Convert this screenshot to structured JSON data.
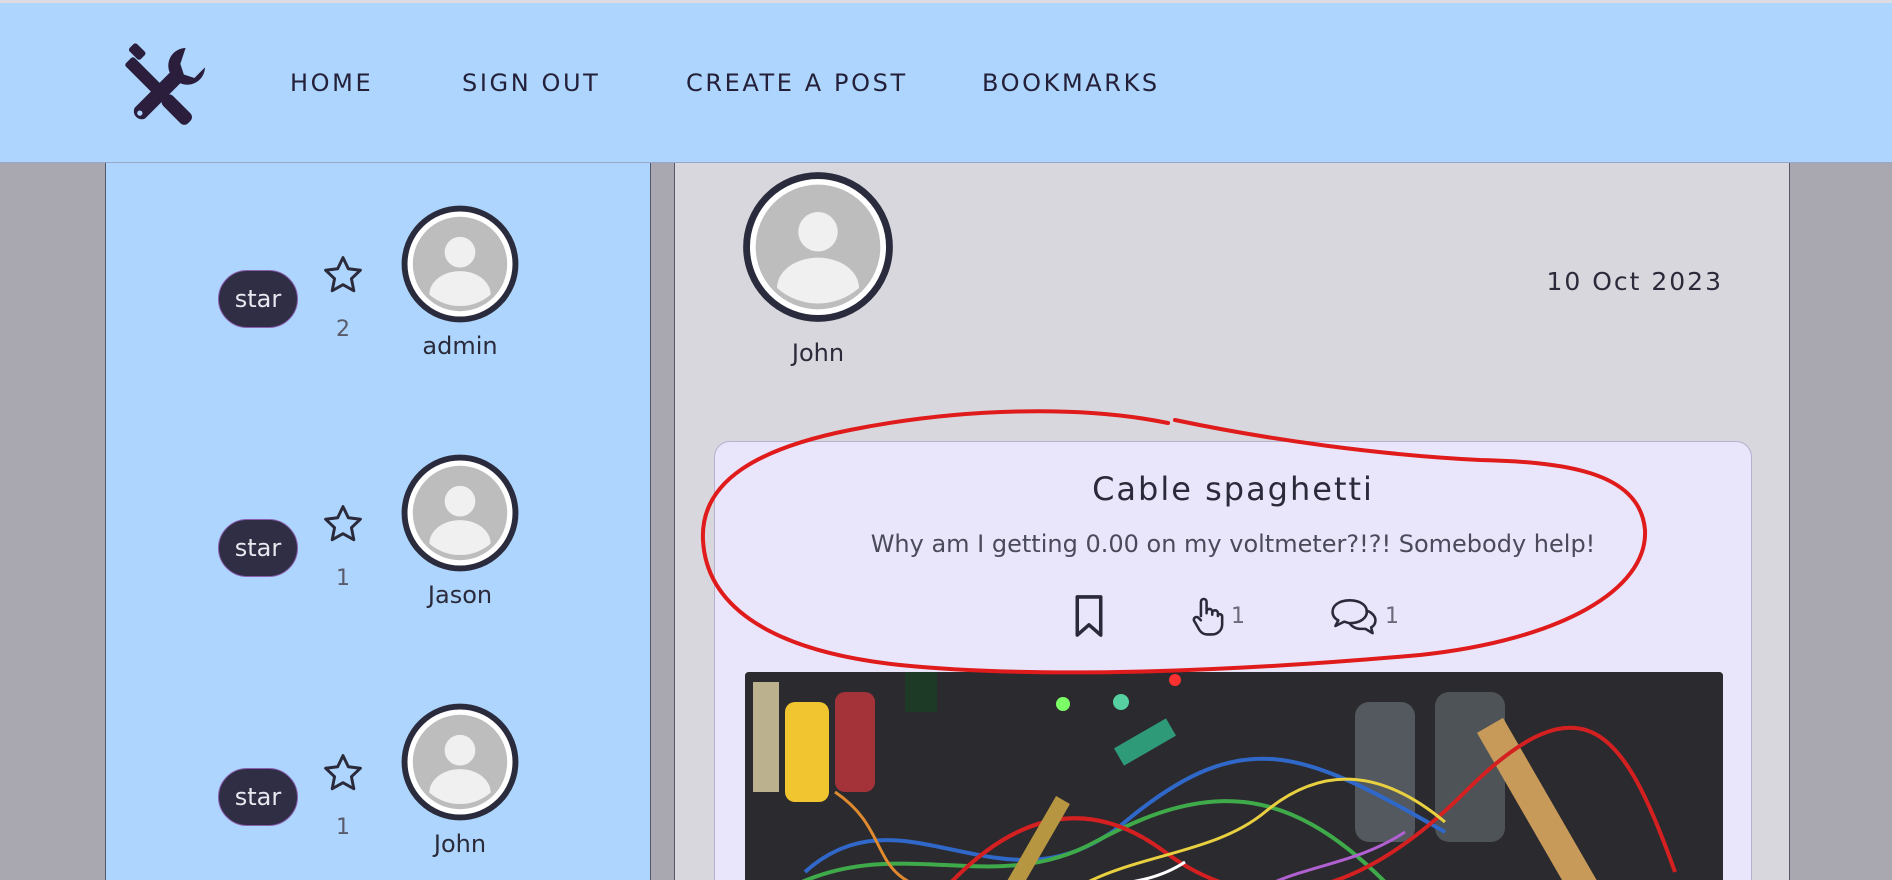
{
  "nav": {
    "links": [
      {
        "label": "HOME"
      },
      {
        "label": "SIGN OUT"
      },
      {
        "label": "CREATE A POST"
      },
      {
        "label": "BOOKMARKS"
      }
    ],
    "logo_icon": "tools-icon"
  },
  "sidebar": {
    "users": [
      {
        "button_label": "star",
        "star_count": "2",
        "name": "admin"
      },
      {
        "button_label": "star",
        "star_count": "1",
        "name": "Jason"
      },
      {
        "button_label": "star",
        "star_count": "1",
        "name": "John"
      }
    ]
  },
  "post": {
    "author": "John",
    "date": "10 Oct 2023",
    "title": "Cable spaghetti",
    "body": "Why am I getting 0.00 on my voltmeter?!?! Somebody help!",
    "like_count": "1",
    "comment_count": "1",
    "image_alt_icon": "cables-photo"
  },
  "colors": {
    "navbar_bg": "#aed5fd",
    "sidebar_bg": "#aed5fd",
    "main_bg": "#d8d7dd",
    "card_bg": "#e9e6fb",
    "star_button_bg": "#2f2e45",
    "annotation_red": "#e01b1b"
  }
}
